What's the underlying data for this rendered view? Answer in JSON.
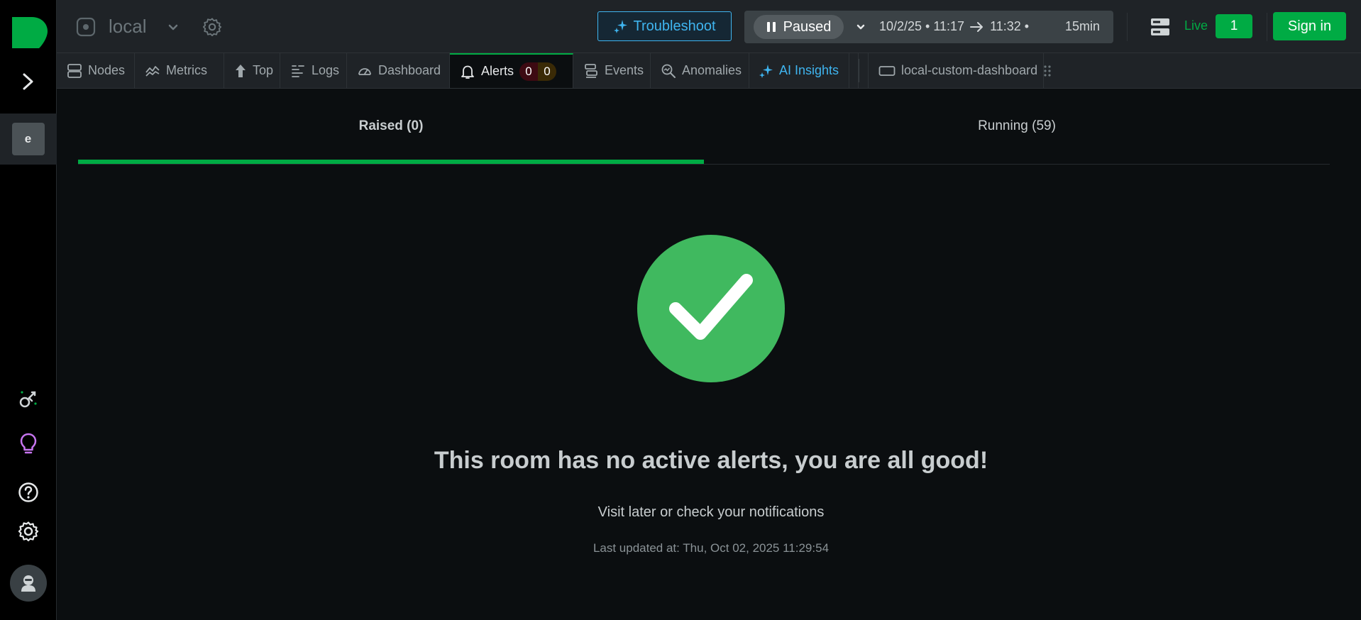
{
  "topbar": {
    "space_name": "local",
    "troubleshoot_label": "Troubleshoot",
    "playback": {
      "state_label": "Paused",
      "time_from": "10/2/25 • 11:17",
      "time_to": "11:32 •",
      "duration": "15min"
    },
    "live_label": "Live",
    "live_count": "1",
    "sign_in_label": "Sign in"
  },
  "sidebar": {
    "space_avatar_letter": "e",
    "icons": [
      "logo-icon",
      "expand-chevron-icon",
      "integrations-icon",
      "lightbulb-icon",
      "help-icon",
      "settings-icon",
      "user-avatar-icon"
    ]
  },
  "tabs": [
    {
      "label": "Nodes",
      "icon": "nodes-icon"
    },
    {
      "label": "Metrics",
      "icon": "metrics-icon"
    },
    {
      "label": "Top",
      "icon": "arrow-up-icon"
    },
    {
      "label": "Logs",
      "icon": "logs-icon"
    },
    {
      "label": "Dashboard",
      "icon": "gauge-icon"
    },
    {
      "label": "Alerts",
      "icon": "bell-icon",
      "critical": "0",
      "warning": "0"
    },
    {
      "label": "Events",
      "icon": "events-icon"
    },
    {
      "label": "Anomalies",
      "icon": "anomalies-icon"
    },
    {
      "label": "AI Insights",
      "icon": "sparkle-icon"
    },
    {
      "label": "local-custom-dashboard",
      "icon": "dashboard-window-icon"
    }
  ],
  "alerts": {
    "subtabs": [
      {
        "label": "Raised (0)"
      },
      {
        "label": "Running (59)"
      }
    ],
    "empty_title": "This room has no active alerts, you are all good!",
    "empty_subtitle": "Visit later or check your notifications",
    "last_updated": "Last updated at: Thu, Oct 02, 2025 11:29:54"
  },
  "colors": {
    "accent_green": "#00ab44",
    "check_green": "#40b95f",
    "ai_blue": "#3fb5f0",
    "background": "#0b0e10",
    "bar_background": "#1f2327"
  }
}
